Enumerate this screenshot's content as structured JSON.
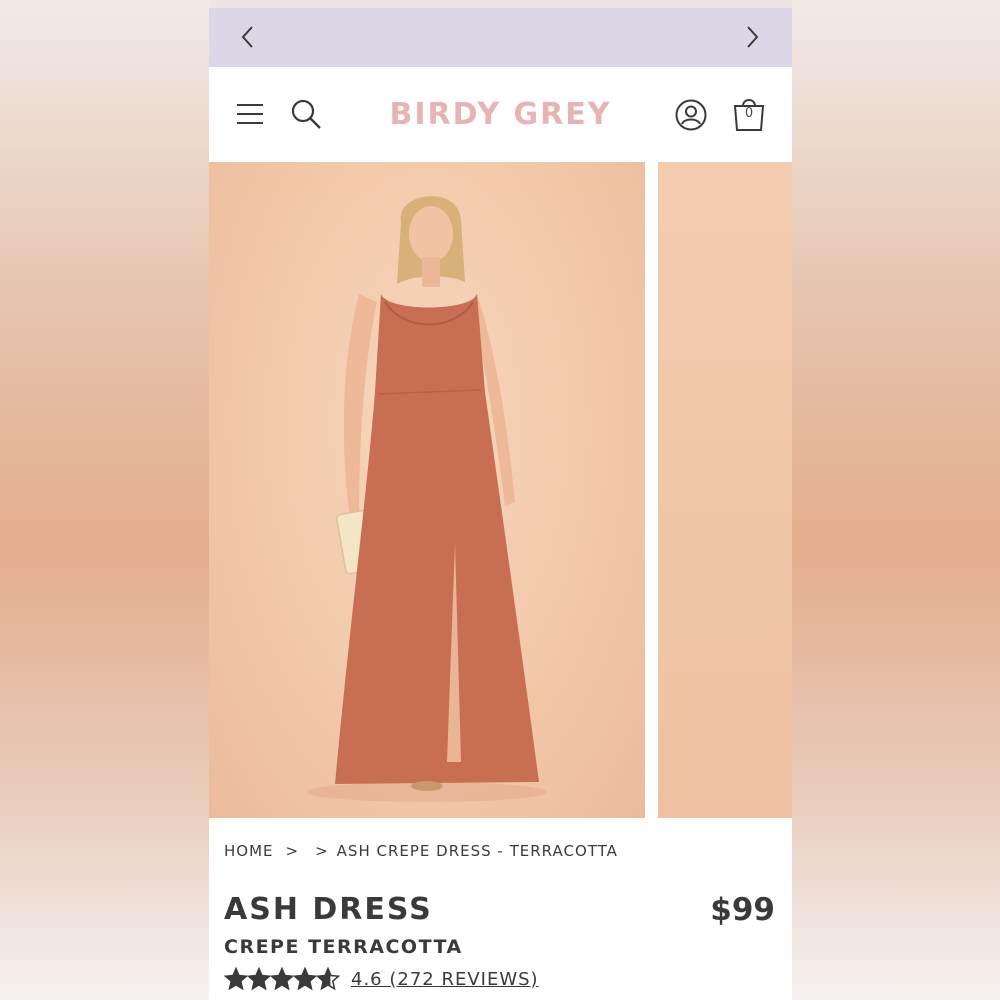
{
  "brand": {
    "logo_text": "BIRDY GREY",
    "logo_color": "#e7b3b5"
  },
  "promo_bar": {
    "color": "#dcd7e6",
    "prev_icon": "chevron-left-icon",
    "next_icon": "chevron-right-icon"
  },
  "header": {
    "menu_icon": "hamburger-menu-icon",
    "search_icon": "search-icon",
    "account_icon": "account-icon",
    "cart_icon": "shopping-bag-icon",
    "cart_count": "0"
  },
  "gallery": {
    "slides": 2,
    "dress_color": "#c86e53",
    "background_color": "#f2c7a8"
  },
  "breadcrumb": {
    "home": "HOME",
    "separator": ">",
    "current": "ASH CREPE DRESS - TERRACOTTA"
  },
  "product": {
    "name": "ASH DRESS",
    "variant": "CREPE TERRACOTTA",
    "price": "$99",
    "rating_value": 4.6,
    "rating_max": 5,
    "rating_text": "4.6 (272 REVIEWS)"
  }
}
